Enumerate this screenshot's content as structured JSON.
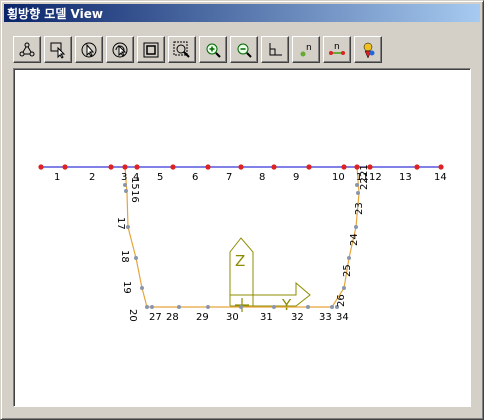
{
  "window": {
    "title": "횡방향 모델 View"
  },
  "toolbar": {
    "buttons": [
      {
        "name": "node-tool-button",
        "icon": "nodes-icon"
      },
      {
        "name": "select-tool-button",
        "icon": "select-icon"
      },
      {
        "name": "pointer-button",
        "icon": "pointer-icon"
      },
      {
        "name": "rotate-button",
        "icon": "rotate-icon"
      },
      {
        "name": "fit-window-button",
        "icon": "fit-window-icon"
      },
      {
        "name": "zoom-window-button",
        "icon": "zoom-window-icon"
      },
      {
        "name": "zoom-in-button",
        "icon": "zoom-in-icon"
      },
      {
        "name": "zoom-out-button",
        "icon": "zoom-out-icon"
      },
      {
        "name": "axis-view-button",
        "icon": "axis-icon"
      },
      {
        "name": "node-number-button",
        "icon": "node-number-icon"
      },
      {
        "name": "element-number-button",
        "icon": "element-number-icon"
      },
      {
        "name": "color-settings-button",
        "icon": "palette-icon"
      }
    ]
  },
  "model": {
    "colors": {
      "deck": "#0000cc",
      "web": "#e6a53c",
      "axes": "#8c8c00",
      "deck_node": "#dd2222",
      "web_node": "#8c96aa"
    },
    "axis_labels": {
      "z": "Z",
      "y": "Y"
    },
    "deck_labels": [
      "1",
      "2",
      "3",
      "4",
      "5",
      "6",
      "7",
      "8",
      "9",
      "10",
      "11",
      "12",
      "13",
      "14"
    ],
    "left_web_labels": [
      "15",
      "16",
      "17",
      "18",
      "19",
      "20"
    ],
    "bottom_labels": [
      "27",
      "28",
      "29",
      "30",
      "31",
      "32",
      "33",
      "34"
    ],
    "right_web_labels": [
      "21",
      "22",
      "23",
      "24",
      "25",
      "26"
    ]
  }
}
